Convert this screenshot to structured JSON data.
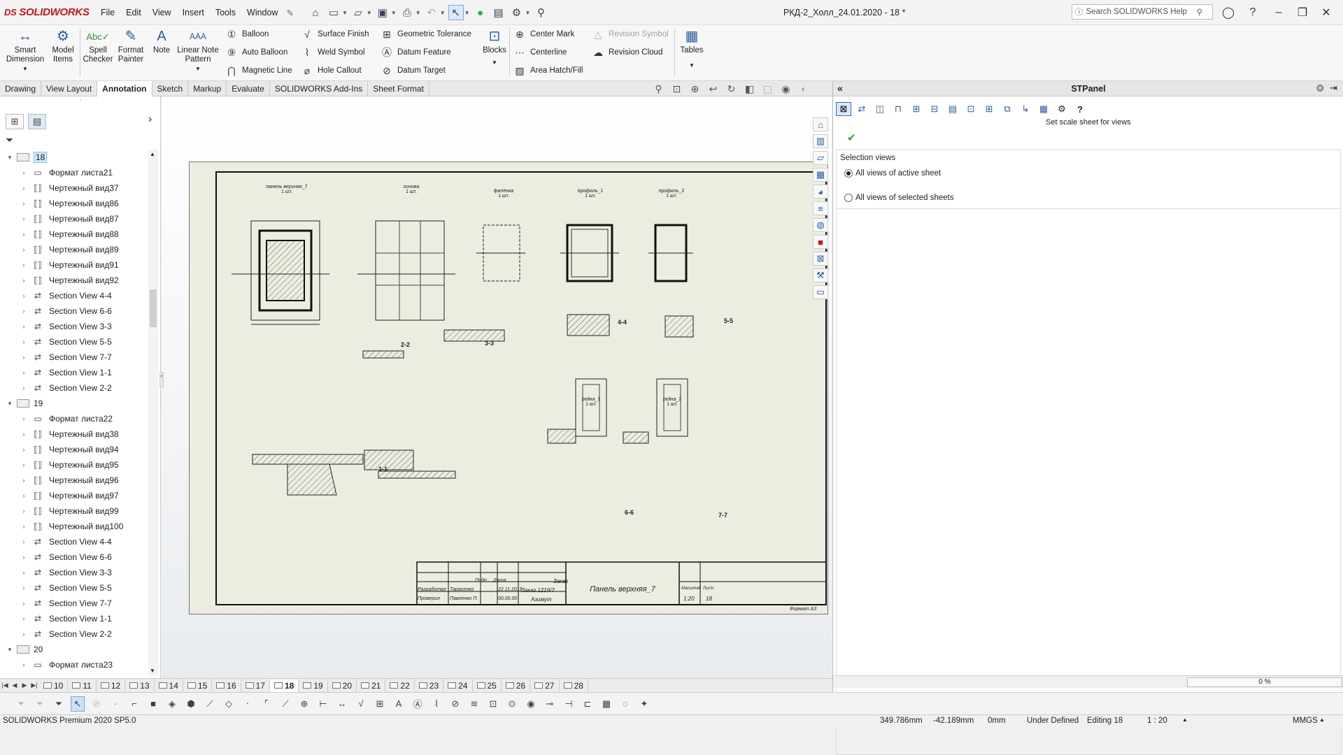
{
  "titlebar": {
    "logo": "SOLIDWORKS",
    "logo_prefix": "DS",
    "menus": [
      "File",
      "Edit",
      "View",
      "Insert",
      "Tools",
      "Window"
    ],
    "pin_icon": "pushpin-icon",
    "document_title": "РКД-2_Холл_24.01.2020 - 18 *",
    "search_placeholder": "Search SOLIDWORKS Help",
    "icons": [
      "home-icon",
      "new-document-icon",
      "open-icon",
      "save-icon",
      "print-icon",
      "undo-icon",
      "select-icon",
      "rebuild-icon",
      "file-properties-icon",
      "options-icon",
      "search-icon"
    ]
  },
  "commands": {
    "smart_dimension": "Smart Dimension",
    "model_items": "Model Items",
    "spell_checker": "Spell Checker",
    "format_painter": "Format Painter",
    "note": "Note",
    "linear_note_pattern": "Linear Note Pattern",
    "balloon": "Balloon",
    "auto_balloon": "Auto Balloon",
    "magnetic_line": "Magnetic Line",
    "surface_finish": "Surface Finish",
    "weld_symbol": "Weld Symbol",
    "hole_callout": "Hole Callout",
    "geometric_tolerance": "Geometric Tolerance",
    "datum_feature": "Datum Feature",
    "datum_target": "Datum Target",
    "blocks": "Blocks",
    "center_mark": "Center Mark",
    "centerline": "Centerline",
    "area_hatch_fill": "Area Hatch/Fill",
    "revision_symbol": "Revision Symbol",
    "revision_cloud": "Revision Cloud",
    "tables": "Tables"
  },
  "tabs": [
    "Drawing",
    "View Layout",
    "Annotation",
    "Sketch",
    "Markup",
    "Evaluate",
    "SOLIDWORKS Add-Ins",
    "Sheet Format"
  ],
  "active_tab": "Annotation",
  "tree": {
    "items": [
      {
        "label": "18",
        "type": "sheet",
        "level": 0,
        "expanded": true,
        "selected": true
      },
      {
        "label": "Формат листа21",
        "type": "format",
        "level": 1
      },
      {
        "label": "Чертежный вид37",
        "type": "view",
        "level": 1
      },
      {
        "label": "Чертежный вид86",
        "type": "view",
        "level": 1
      },
      {
        "label": "Чертежный вид87",
        "type": "view",
        "level": 1
      },
      {
        "label": "Чертежный вид88",
        "type": "view",
        "level": 1
      },
      {
        "label": "Чертежный вид89",
        "type": "view",
        "level": 1
      },
      {
        "label": "Чертежный вид91",
        "type": "view",
        "level": 1
      },
      {
        "label": "Чертежный вид92",
        "type": "view",
        "level": 1
      },
      {
        "label": "Section View 4-4",
        "type": "section",
        "level": 1
      },
      {
        "label": "Section View 6-6",
        "type": "section",
        "level": 1
      },
      {
        "label": "Section View 3-3",
        "type": "section",
        "level": 1
      },
      {
        "label": "Section View 5-5",
        "type": "section",
        "level": 1
      },
      {
        "label": "Section View 7-7",
        "type": "section",
        "level": 1
      },
      {
        "label": "Section View 1-1",
        "type": "section",
        "level": 1
      },
      {
        "label": "Section View 2-2",
        "type": "section",
        "level": 1
      },
      {
        "label": "19",
        "type": "sheet",
        "level": 0,
        "expanded": true
      },
      {
        "label": "Формат листа22",
        "type": "format",
        "level": 1
      },
      {
        "label": "Чертежный вид38",
        "type": "view",
        "level": 1
      },
      {
        "label": "Чертежный вид94",
        "type": "view",
        "level": 1
      },
      {
        "label": "Чертежный вид95",
        "type": "view",
        "level": 1
      },
      {
        "label": "Чертежный вид96",
        "type": "view",
        "level": 1
      },
      {
        "label": "Чертежный вид97",
        "type": "view",
        "level": 1
      },
      {
        "label": "Чертежный вид99",
        "type": "view",
        "level": 1
      },
      {
        "label": "Чертежный вид100",
        "type": "view",
        "level": 1
      },
      {
        "label": "Section View 4-4",
        "type": "section",
        "level": 1
      },
      {
        "label": "Section View 6-6",
        "type": "section",
        "level": 1
      },
      {
        "label": "Section View 3-3",
        "type": "section",
        "level": 1
      },
      {
        "label": "Section View 5-5",
        "type": "section",
        "level": 1
      },
      {
        "label": "Section View 7-7",
        "type": "section",
        "level": 1
      },
      {
        "label": "Section View 1-1",
        "type": "section",
        "level": 1
      },
      {
        "label": "Section View 2-2",
        "type": "section",
        "level": 1
      },
      {
        "label": "20",
        "type": "sheet",
        "level": 0,
        "expanded": true
      },
      {
        "label": "Формат листа23",
        "type": "format",
        "level": 1
      }
    ]
  },
  "drawing": {
    "views": [
      {
        "title": "панель верхняя_7",
        "qty": "1 шт."
      },
      {
        "title": "основа",
        "qty": "1 шт."
      },
      {
        "title": "филёнка",
        "qty": "1 шт."
      },
      {
        "title": "профиль_1",
        "qty": "1 шт."
      },
      {
        "title": "профиль_2",
        "qty": "1 шт."
      },
      {
        "title": "рейка_1",
        "qty": "1 шт."
      },
      {
        "title": "рейка_2",
        "qty": "1 шт."
      }
    ],
    "sections": [
      "2-2",
      "3-3",
      "4-4",
      "5-5",
      "1-1",
      "6-6",
      "7-7"
    ],
    "titleblock": {
      "developed": "Разработал",
      "developer": "Тарасенко",
      "checked": "Проверил",
      "checker": "Павленко П.",
      "sign_col": "Подп.",
      "date_col": "Дата",
      "date1": "22.11.2019",
      "date2": "00.00.00",
      "order_label": "Заказ",
      "order": "Заказ 1219/7",
      "company": "Азимут",
      "part_name": "Панель верхняя_7",
      "scale_label": "Масштаб",
      "scale": "1:20",
      "sheet_label": "Лист",
      "sheet": "18",
      "format": "Формат А3"
    }
  },
  "stpanel": {
    "title": "STPanel",
    "hint": "Set scale sheet for views",
    "group_title": "Selection views",
    "options": [
      "All views of active sheet",
      "All views of selected sheets"
    ],
    "selected_option": 0,
    "progress_text": "0 %"
  },
  "sheettabs": {
    "tabs": [
      "10",
      "11",
      "12",
      "13",
      "14",
      "15",
      "16",
      "17",
      "18",
      "19",
      "20",
      "21",
      "22",
      "23",
      "24",
      "25",
      "26",
      "27",
      "28"
    ],
    "active": "18"
  },
  "statusbar": {
    "product": "SOLIDWORKS Premium 2020 SP5.0",
    "x": "349.786mm",
    "y": "-42.189mm",
    "z": "0mm",
    "state": "Under Defined",
    "editing": "Editing 18",
    "scale": "1 : 20",
    "units": "MMGS"
  },
  "colors": {
    "accent": "#2a5d9f",
    "sheet_bg": "#ecece0",
    "logo_red": "#c4161c"
  }
}
